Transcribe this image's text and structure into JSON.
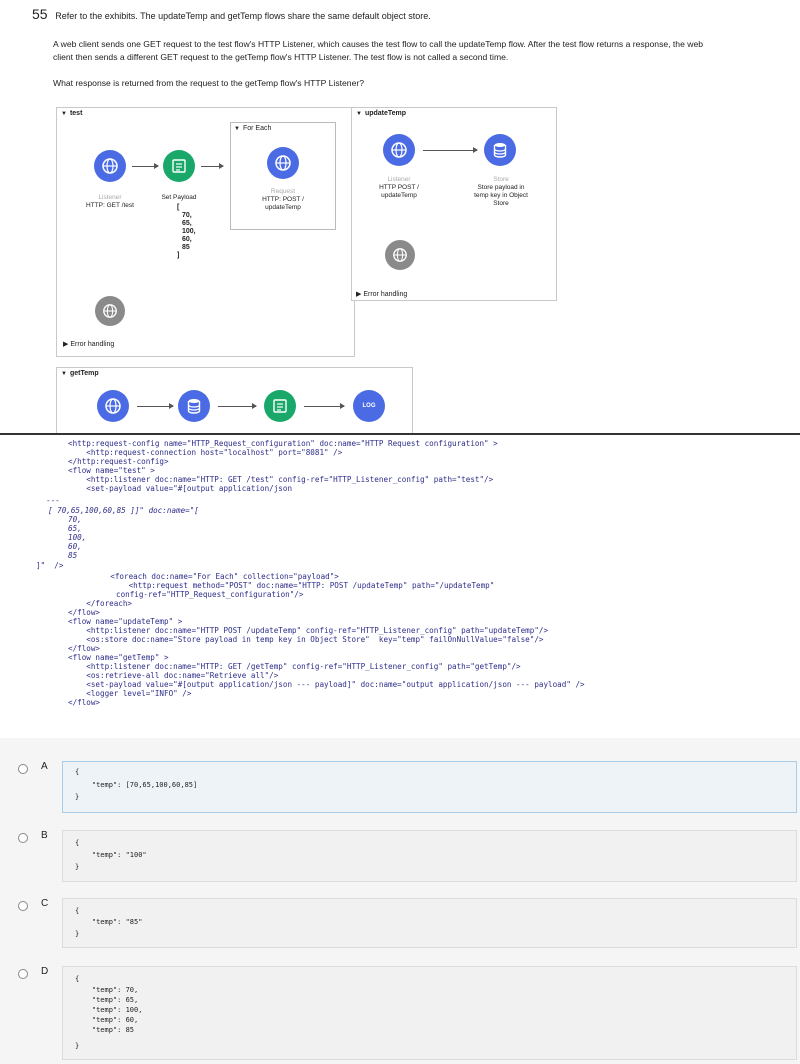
{
  "question": {
    "number": "55",
    "intro": "Refer to the exhibits. The updateTemp and getTemp flows share the same default object store.",
    "para1_line1": "A web client sends one GET request to the test flow's HTTP Listener, which causes the test flow to call the updateTemp flow. After the test flow returns a response, the web",
    "para1_line2": "client then sends a different GET request to the getTemp flow's HTTP Listener. The test flow is not called a second time.",
    "prompt": "What response is returned from the request to the getTemp flow's HTTP Listener?"
  },
  "diagram": {
    "test_flow": {
      "title": "test",
      "listener_sub": "Listener",
      "listener_label": "HTTP: GET /test",
      "setpayload_sub": "Set Payload",
      "payload_values": [
        "[",
        "70,",
        "65,",
        "100,",
        "60,",
        "85",
        "]"
      ],
      "foreach_title": "For Each",
      "request_sub": "Request",
      "request_label_1": "HTTP: POST /",
      "request_label_2": "updateTemp",
      "error_handling": "Error handling"
    },
    "update_flow": {
      "title": "updateTemp",
      "listener_sub": "Listener",
      "listener_label_1": "HTTP POST /",
      "listener_label_2": "updateTemp",
      "store_sub": "Store",
      "store_label_1": "Store payload in",
      "store_label_2": "temp key in Object",
      "store_label_3": "Store",
      "error_handling": "Error handling"
    },
    "get_flow": {
      "title": "getTemp",
      "logger_text": "LOG"
    }
  },
  "code_lines": [
    "<http:request-config name=\"HTTP_Request_configuration\" doc:name=\"HTTP Request configuration\" >",
    "    <http:request-connection host=\"localhost\" port=\"8081\" />",
    "</http:request-config>",
    "<flow name=\"test\" >",
    "    <http:listener doc:name=\"HTTP: GET /test\" config-ref=\"HTTP_Listener_config\" path=\"test\"/>",
    "    <set-payload value=\"#[output application/json",
    "---",
    "[ 70,65,100,60,85 ]]\" doc:name=\"[",
    "70,",
    "65,",
    "100,",
    "60,",
    "85",
    "]\"  />",
    "    <foreach doc:name=\"For Each\" collection=\"payload\">",
    "        <http:request method=\"POST\" doc:name=\"HTTP: POST /updateTemp\" path=\"/updateTemp\"",
    "config-ref=\"HTTP_Request_configuration\"/>",
    "    </foreach>",
    "</flow>",
    "<flow name=\"updateTemp\" >",
    "    <http:listener doc:name=\"HTTP POST /updateTemp\" config-ref=\"HTTP_Listener_config\" path=\"updateTemp\"/>",
    "    <os:store doc:name=\"Store payload in temp key in Object Store\"  key=\"temp\" failOnNullValue=\"false\"/>",
    "</flow>",
    "<flow name=\"getTemp\" >",
    "    <http:listener doc:name=\"HTTP: GET /getTemp\" config-ref=\"HTTP_Listener_config\" path=\"getTemp\"/>",
    "    <os:retrieve-all doc:name=\"Retrieve all\"/>",
    "    <set-payload value=\"#[output application/json --- payload]\" doc:name=\"output application/json --- payload\" />",
    "    <logger level=\"INFO\" />",
    "</flow>"
  ],
  "options": [
    {
      "letter": "A",
      "lines": [
        "{",
        "    \"temp\": [70,65,100,60,85]",
        "}"
      ]
    },
    {
      "letter": "B",
      "lines": [
        "{",
        "    \"temp\": \"100\"",
        "}"
      ]
    },
    {
      "letter": "C",
      "lines": [
        "{",
        "    \"temp\": \"85\"",
        "}"
      ]
    },
    {
      "letter": "D",
      "lines": [
        "{",
        "    \"temp\": 70,",
        "    \"temp\": 65,",
        "    \"temp\": 100,",
        "    \"temp\": 60,",
        "    \"temp\": 85",
        "}"
      ]
    }
  ],
  "colors": {
    "listener": "#4b6be4",
    "setpayload": "#1aa86a",
    "error": "#8a8a8a",
    "code": "#2e2e8a"
  }
}
